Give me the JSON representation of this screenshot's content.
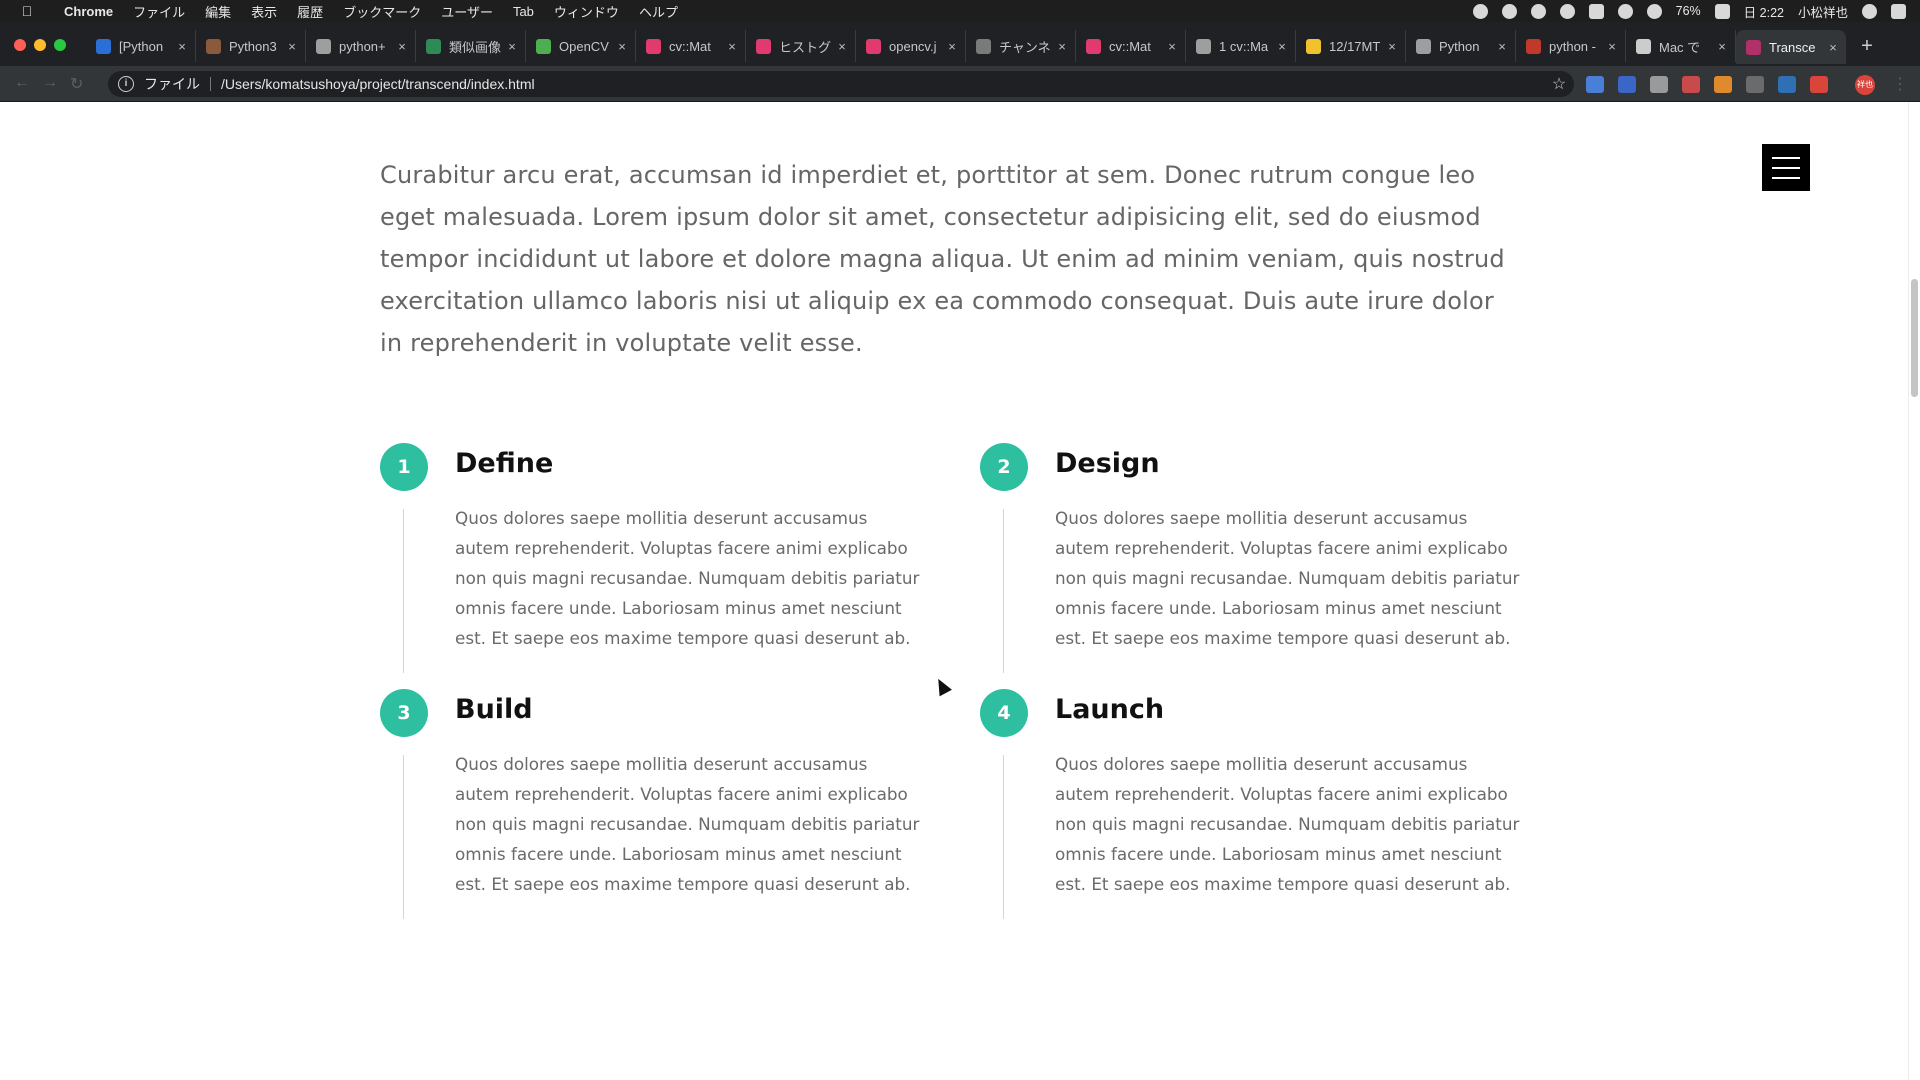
{
  "menubar": {
    "app": "Chrome",
    "items": [
      "ファイル",
      "編集",
      "表示",
      "履歴",
      "ブックマーク",
      "ユーザー",
      "Tab",
      "ウィンドウ",
      "ヘルプ"
    ],
    "battery": "76%",
    "clock": "日 2:22",
    "user": "小松祥也"
  },
  "tabs": [
    {
      "title": "[Python",
      "color": "#2a6fd6"
    },
    {
      "title": "Python3",
      "color": "#8a5a3b"
    },
    {
      "title": "python+",
      "color": "#9e9e9e"
    },
    {
      "title": "類似画像",
      "color": "#2e8b57"
    },
    {
      "title": "OpenCV",
      "color": "#4caf50"
    },
    {
      "title": "cv::Mat",
      "color": "#e03a6e"
    },
    {
      "title": "ヒストグ",
      "color": "#e03a6e"
    },
    {
      "title": "opencv.j",
      "color": "#e03a6e"
    },
    {
      "title": "チャンネ",
      "color": "#7a7a7a"
    },
    {
      "title": "cv::Mat",
      "color": "#e03a6e"
    },
    {
      "title": "1 cv::Ma",
      "color": "#9e9e9e"
    },
    {
      "title": "12/17MT",
      "color": "#f2c22e"
    },
    {
      "title": "Python",
      "color": "#9e9e9e"
    },
    {
      "title": "python -",
      "color": "#c0392b"
    },
    {
      "title": "Mac で",
      "color": "#cccccc"
    },
    {
      "title": "Transce",
      "color": "#b0306a",
      "active": true
    }
  ],
  "address": {
    "scheme": "ファイル",
    "url": "/Users/komatsushoya/project/transcend/index.html"
  },
  "extensions": [
    "#4a7fd8",
    "#3a66c7",
    "#9a9a9a",
    "#c94a4a",
    "#e08a2e",
    "#6b6b6b",
    "#2f6fb3",
    "#d9443b"
  ],
  "profile_label": "祥也",
  "page": {
    "intro": "Curabitur arcu erat, accumsan id imperdiet et, porttitor at sem. Donec rutrum congue leo eget malesuada. Lorem ipsum dolor sit amet, consectetur adipisicing elit, sed do eiusmod tempor incididunt ut labore et dolore magna aliqua. Ut enim ad minim veniam, quis nostrud exercitation ullamco laboris nisi ut aliquip ex ea commodo consequat. Duis aute irure dolor in reprehenderit in voluptate velit esse.",
    "steps": [
      {
        "number": "1",
        "title": "Define",
        "body": "Quos dolores saepe mollitia deserunt accusamus autem reprehenderit. Voluptas facere animi explicabo non quis magni recusandae. Numquam debitis pariatur omnis facere unde. Laboriosam minus amet nesciunt est. Et saepe eos maxime tempore quasi deserunt ab."
      },
      {
        "number": "2",
        "title": "Design",
        "body": "Quos dolores saepe mollitia deserunt accusamus autem reprehenderit. Voluptas facere animi explicabo non quis magni recusandae. Numquam debitis pariatur omnis facere unde. Laboriosam minus amet nesciunt est. Et saepe eos maxime tempore quasi deserunt ab."
      },
      {
        "number": "3",
        "title": "Build",
        "body": "Quos dolores saepe mollitia deserunt accusamus autem reprehenderit. Voluptas facere animi explicabo non quis magni recusandae. Numquam debitis pariatur omnis facere unde. Laboriosam minus amet nesciunt est. Et saepe eos maxime tempore quasi deserunt ab."
      },
      {
        "number": "4",
        "title": "Launch",
        "body": "Quos dolores saepe mollitia deserunt accusamus autem reprehenderit. Voluptas facere animi explicabo non quis magni recusandae. Numquam debitis pariatur omnis facere unde. Laboriosam minus amet nesciunt est. Et saepe eos maxime tempore quasi deserunt ab."
      }
    ],
    "accent_color": "#2ebfa0"
  }
}
